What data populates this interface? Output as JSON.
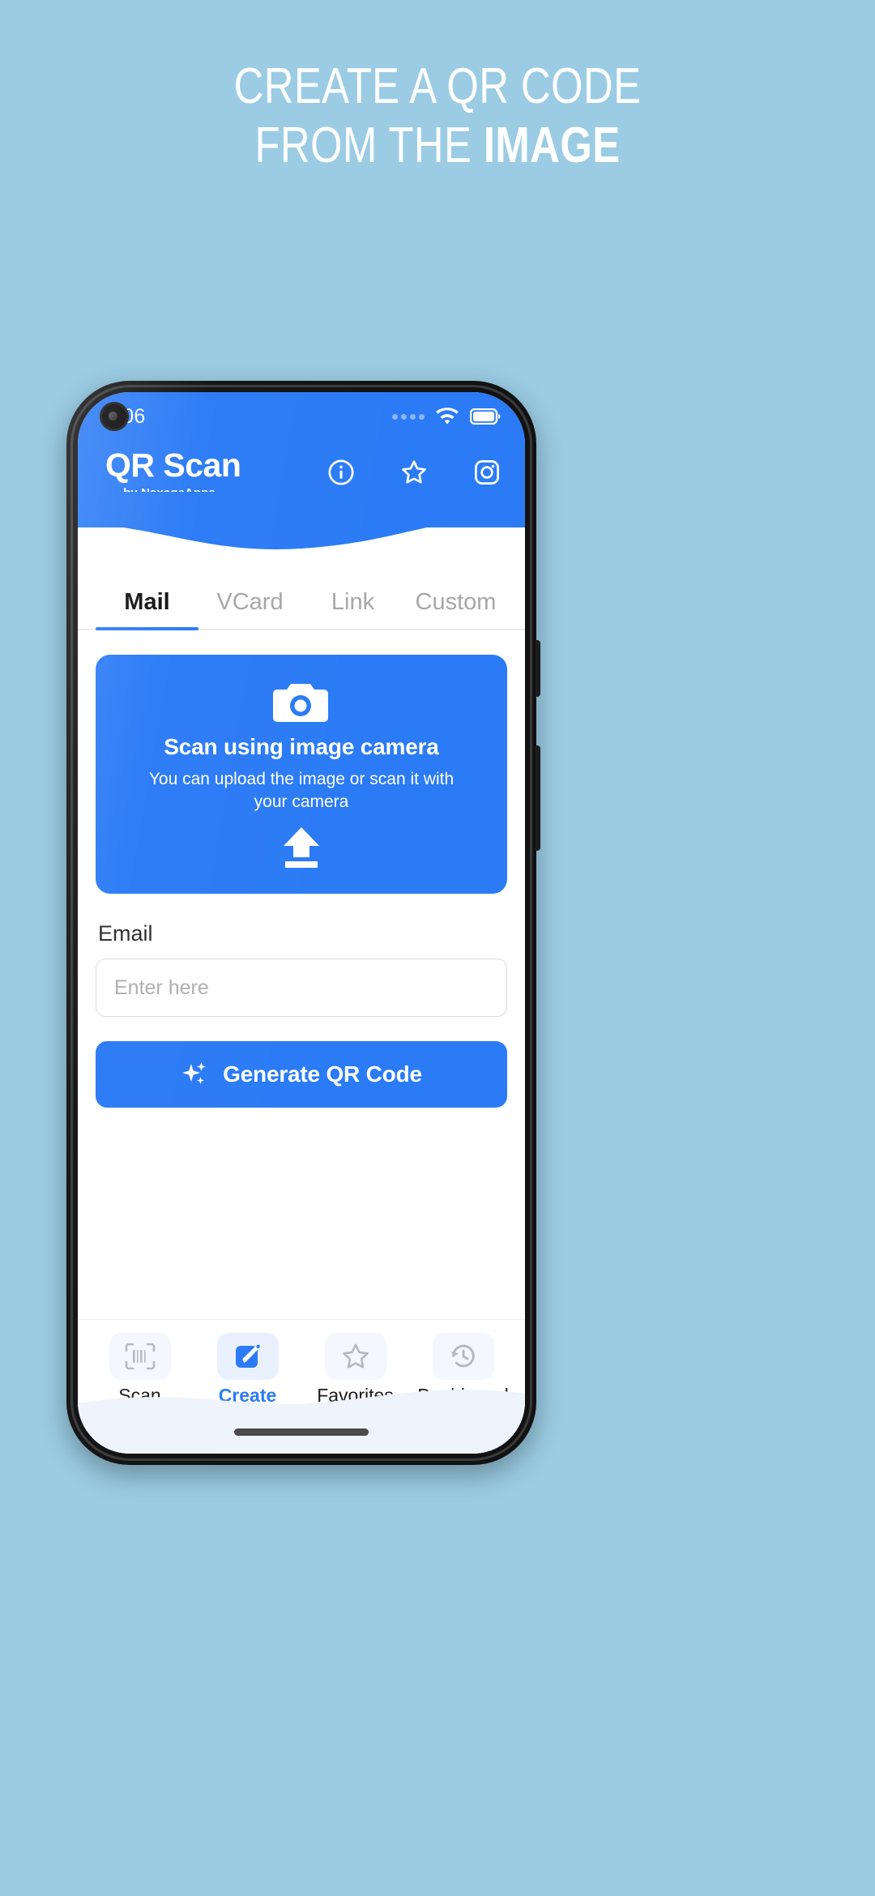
{
  "promo": {
    "line1": "CREATE A QR CODE",
    "line2_normal": "FROM THE ",
    "line2_bold": "IMAGE",
    "background_color": "#9BCCE4",
    "text_color": "#FFFFFF"
  },
  "status_bar": {
    "time": "5:06",
    "signal_icon": "signal-dots-icon",
    "wifi_icon": "wifi-icon",
    "battery_icon": "battery-full-icon"
  },
  "app_header": {
    "title": "QR Scan",
    "subtitle": "by NexageApps",
    "accent_color": "#2B7BF6",
    "actions": [
      {
        "name": "info-icon",
        "label": "Info"
      },
      {
        "name": "star-icon",
        "label": "Favorites"
      },
      {
        "name": "instagram-icon",
        "label": "Instagram"
      }
    ]
  },
  "tabs": {
    "items": [
      {
        "label": "Mail",
        "active": true
      },
      {
        "label": "VCard",
        "active": false
      },
      {
        "label": "Link",
        "active": false
      },
      {
        "label": "Custom",
        "active": false
      }
    ],
    "active_color": "#2B7BF6",
    "inactive_color": "#A7A7A7"
  },
  "scan_card": {
    "camera_icon": "camera-icon",
    "title": "Scan using image camera",
    "description": "You can upload the image or scan it with your camera",
    "upload_icon": "upload-icon",
    "background_color": "#2B7BF6"
  },
  "form": {
    "label": "Email",
    "placeholder": "Enter here",
    "value": ""
  },
  "generate_button": {
    "label": "Generate QR Code",
    "icon": "sparkles-icon",
    "color": "#2B7BF6"
  },
  "bottom_nav": {
    "items": [
      {
        "label": "Scan",
        "icon": "barcode-scan-icon",
        "active": false
      },
      {
        "label": "Create",
        "icon": "edit-square-icon",
        "active": true
      },
      {
        "label": "Favorites",
        "icon": "star-outline-icon",
        "active": false
      },
      {
        "label": "Dashboard",
        "icon": "history-clock-icon",
        "active": false
      }
    ],
    "active_color": "#2B7BF6"
  }
}
